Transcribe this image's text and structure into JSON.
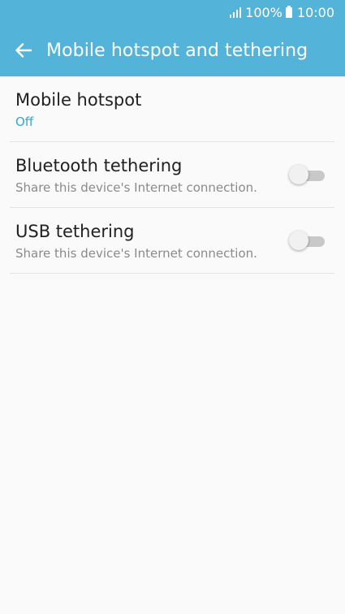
{
  "status_bar": {
    "battery": "100%",
    "time": "10:00",
    "signal_icon": "signal-icon",
    "battery_icon": "battery-icon"
  },
  "header": {
    "title": "Mobile hotspot and tethering",
    "back_icon": "arrow-back-icon"
  },
  "items": [
    {
      "title": "Mobile hotspot",
      "subtitle": "Off"
    },
    {
      "title": "Bluetooth tethering",
      "subtitle": "Share this device's Internet connection.",
      "enabled": false
    },
    {
      "title": "USB tethering",
      "subtitle": "Share this device's Internet connection.",
      "enabled": false
    }
  ],
  "colors": {
    "accent": "#54b3d8",
    "status_text": "#3aa4c9"
  }
}
